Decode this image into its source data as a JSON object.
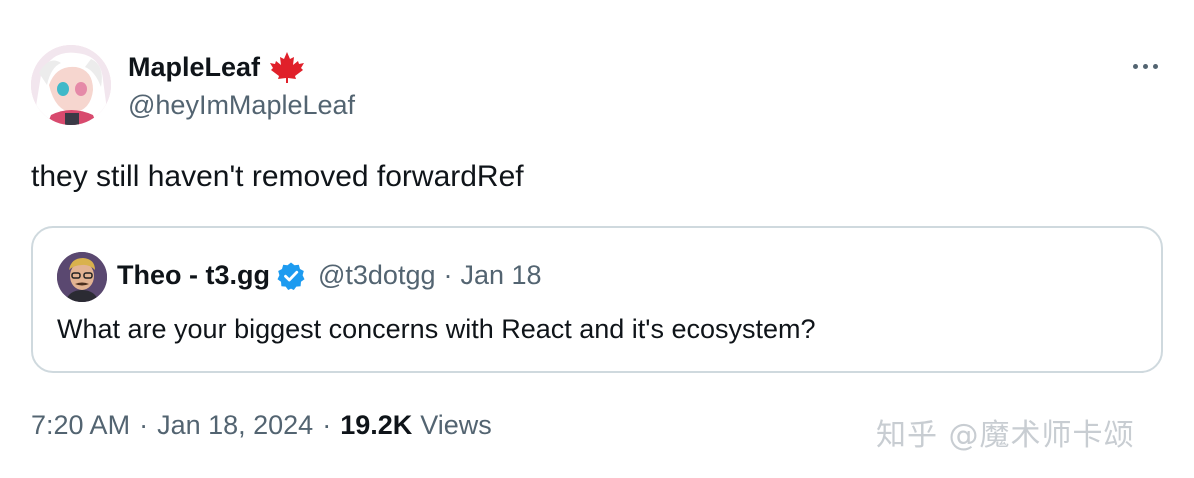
{
  "author": {
    "name": "MapleLeaf",
    "handle": "@heyImMapleLeaf"
  },
  "tweet": {
    "text": "they still haven't removed forwardRef"
  },
  "quote": {
    "name": "Theo - t3.gg",
    "handle": "@t3dotgg",
    "separator": "·",
    "date": "Jan 18",
    "text": "What are your biggest concerns with React and it's ecosystem?"
  },
  "meta": {
    "time": "7:20 AM",
    "separator": "·",
    "date": "Jan 18, 2024",
    "views_count": "19.2K",
    "views_label": "Views"
  },
  "watermark": "知乎 @魔术师卡颂",
  "icons": {
    "flag": "maple-leaf-icon",
    "verified": "verified-badge-icon",
    "more": "more-options-icon"
  },
  "colors": {
    "text": "#0f1419",
    "secondary": "#536471",
    "border": "#cfd9de",
    "verified": "#1d9bf0",
    "maple": "#e0202a"
  }
}
